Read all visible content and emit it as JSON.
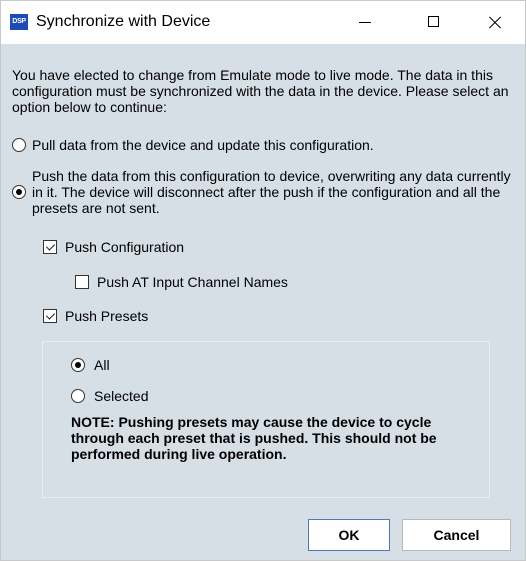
{
  "window": {
    "title": "Synchronize with Device",
    "app_icon_text": "DSP"
  },
  "intro_text": "You have elected to change from Emulate mode to live mode. The data in this configuration must be synchronized with the data in the device. Please select an option below to continue:",
  "options": {
    "pull": {
      "label": "Pull data from the device and update this configuration.",
      "selected": false
    },
    "push": {
      "label": "Push the data from this configuration to device, overwriting any data currently in it. The device will disconnect after the push if the configuration and all the presets are not sent.",
      "selected": true
    }
  },
  "checks": {
    "push_configuration": {
      "label": "Push Configuration",
      "checked": true
    },
    "push_at_names": {
      "label": "Push AT Input Channel Names",
      "checked": false
    },
    "push_presets": {
      "label": "Push Presets",
      "checked": true
    }
  },
  "preset_scope": {
    "all": {
      "label": "All",
      "selected": true
    },
    "selected": {
      "label": "Selected",
      "selected": false
    }
  },
  "note": "NOTE: Pushing presets may cause the device to cycle through each preset that is pushed. This should not be performed during live operation.",
  "buttons": {
    "ok": "OK",
    "cancel": "Cancel"
  }
}
